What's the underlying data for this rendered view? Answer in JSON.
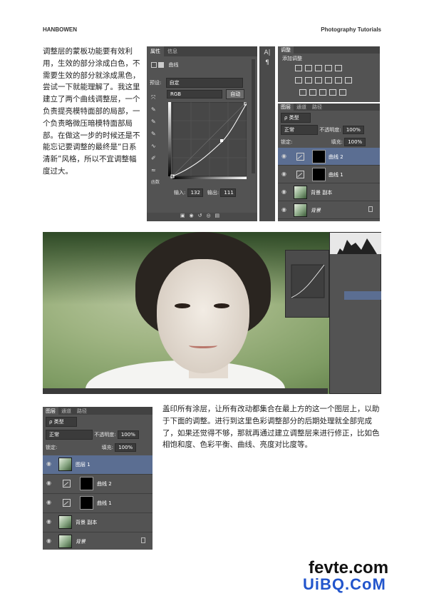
{
  "header": {
    "left": "HANBOWEN",
    "right": "Photography Tutorials"
  },
  "paragraph1": "调整层的蒙板功能要有效利用，生效的部分涂成白色，不需要生效的部分就涂成黑色，尝试一下就能理解了。我这里建立了两个曲线调整层，一个负责提亮模特面部的局部，一个负责略微压暗模特面部局部。在做这一步的时候还是不能忘记要调整的最终是“日系清新”风格，所以不宜调整幅度过大。",
  "paragraph2": "盖印所有涂层，让所有改动都集合在最上方的这一个图层上，以助于下面的调整。进行到这里色彩调整部分的后期处理就全部完成了，如果还觉得不够，那就再通过建立调整层来进行修正，比如色相饱和度、色彩平衡、曲线、亮度对比度等。",
  "properties_panel": {
    "tabs": [
      "属性",
      "信息"
    ],
    "title": "曲线",
    "preset_label": "预设:",
    "preset_value": "自定",
    "channel_value": "RGB",
    "auto_button": "自动",
    "input_label": "输入:",
    "input_value": "132",
    "output_label": "输出:",
    "output_value": "111",
    "side_label": "函数"
  },
  "adjustments_panel": {
    "tab": "调整",
    "title": "添加调整"
  },
  "layers_panel": {
    "tabs": [
      "图层",
      "通道",
      "路径"
    ],
    "kind_label": "ρ 类型",
    "blend_mode": "正常",
    "opacity_label": "不透明度:",
    "opacity_value": "100%",
    "lock_label": "锁定:",
    "fill_label": "填充:",
    "fill_value": "100%",
    "layers_top": [
      "曲线 2",
      "曲线 1",
      "背景 副本",
      "背景"
    ],
    "layers_bottom": [
      "图层 1",
      "曲线 2",
      "曲线 1",
      "背景 副本",
      "背景"
    ]
  },
  "watermark": {
    "line1": "fevte.com",
    "line2": "UiBQ.CoM"
  },
  "colors": {
    "panel": "#535353",
    "dark": "#424242",
    "selected": "#5b6e92",
    "wm_blue": "#2255cc"
  }
}
